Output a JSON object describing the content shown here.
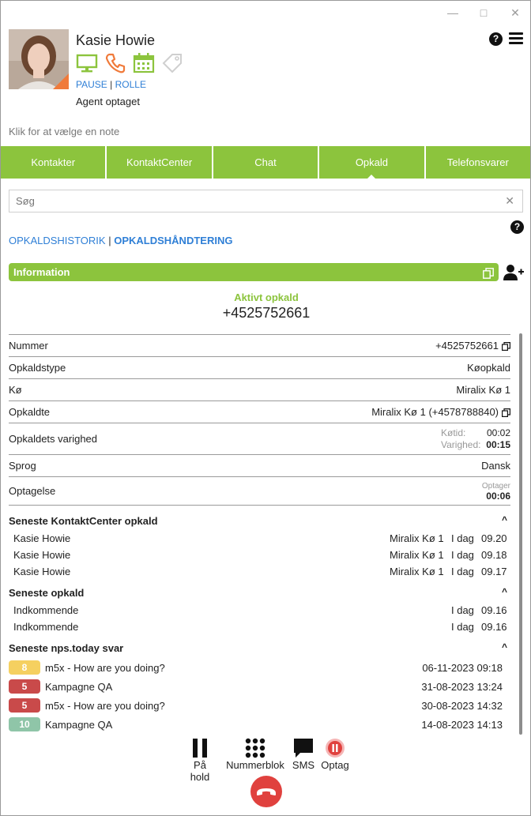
{
  "window": {
    "minimize": "—",
    "maximize": "□",
    "close": "✕"
  },
  "agent": {
    "name": "Kasie Howie",
    "pause_label": "PAUSE",
    "role_label": "ROLLE",
    "separator": "|",
    "status": "Agent optaget"
  },
  "note_placeholder": "Klik for at vælge en note",
  "tabs": [
    {
      "label": "Kontakter"
    },
    {
      "label": "KontaktCenter"
    },
    {
      "label": "Chat"
    },
    {
      "label": "Opkald"
    },
    {
      "label": "Telefonsvarer"
    }
  ],
  "search": {
    "placeholder": "Søg",
    "clear": "✕"
  },
  "subtabs": {
    "history": "OPKALDSHISTORIK",
    "separator": "|",
    "handling": "OPKALDSHÅNDTERING"
  },
  "help": "?",
  "info": {
    "title": "Information"
  },
  "active_call": {
    "label": "Aktivt opkald",
    "number": "+4525752661"
  },
  "details": {
    "number": {
      "label": "Nummer",
      "value": "+4525752661"
    },
    "call_type": {
      "label": "Opkaldstype",
      "value": "Køopkald"
    },
    "queue": {
      "label": "Kø",
      "value": "Miralix Kø 1"
    },
    "called": {
      "label": "Opkaldte",
      "value": "Miralix Kø 1 (+4578788840)"
    },
    "duration": {
      "label": "Opkaldets varighed",
      "queue_time_label": "Køtid:",
      "queue_time": "00:02",
      "duration_label": "Varighed:",
      "duration": "00:15"
    },
    "language": {
      "label": "Sprog",
      "value": "Dansk"
    },
    "recording": {
      "label": "Optagelse",
      "status_label": "Optager",
      "value": "00:06"
    }
  },
  "recent_cc": {
    "title": "Seneste KontaktCenter opkald",
    "chevron": "^",
    "rows": [
      {
        "name": "Kasie Howie",
        "queue": "Miralix Kø 1",
        "day": "I dag",
        "time": "09.20"
      },
      {
        "name": "Kasie Howie",
        "queue": "Miralix Kø 1",
        "day": "I dag",
        "time": "09.18"
      },
      {
        "name": "Kasie Howie",
        "queue": "Miralix Kø 1",
        "day": "I dag",
        "time": "09.17"
      }
    ]
  },
  "recent_calls": {
    "title": "Seneste opkald",
    "chevron": "^",
    "rows": [
      {
        "name": "Indkommende",
        "day": "I dag",
        "time": "09.16"
      },
      {
        "name": "Indkommende",
        "day": "I dag",
        "time": "09.16"
      }
    ]
  },
  "nps": {
    "title": "Seneste nps.today svar",
    "chevron": "^",
    "rows": [
      {
        "score": "8",
        "color": "#f5d060",
        "text": "m5x - How are you doing?",
        "date": "06-11-2023 09:18"
      },
      {
        "score": "5",
        "color": "#c94a4a",
        "text": "Kampagne QA",
        "date": "31-08-2023 13:24"
      },
      {
        "score": "5",
        "color": "#c94a4a",
        "text": "m5x - How are you doing?",
        "date": "30-08-2023 14:32"
      },
      {
        "score": "10",
        "color": "#8fc5a8",
        "text": "Kampagne QA",
        "date": "14-08-2023 14:13"
      }
    ]
  },
  "controls": {
    "hold": "På hold",
    "keypad": "Nummerblok",
    "sms": "SMS",
    "record": "Optag"
  },
  "colors": {
    "accent": "#8cc43d",
    "link": "#2f7fd6",
    "hangup": "#e0413e",
    "orange": "#f07a3a"
  }
}
